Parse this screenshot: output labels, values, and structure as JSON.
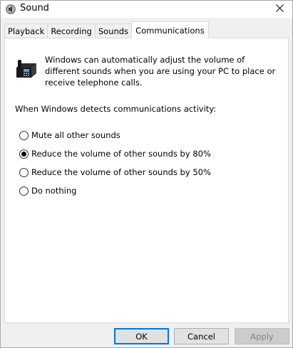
{
  "window": {
    "title": "Sound",
    "app_icon": "speaker-icon",
    "close_icon": "close-icon"
  },
  "tabs": [
    {
      "label": "Playback",
      "active": false
    },
    {
      "label": "Recording",
      "active": false
    },
    {
      "label": "Sounds",
      "active": false
    },
    {
      "label": "Communications",
      "active": true
    }
  ],
  "communications": {
    "icon": "telephone-icon",
    "description": "Windows can automatically adjust the volume of different sounds when you are using your PC to place or receive telephone calls.",
    "detect_label": "When Windows detects communications activity:",
    "options": [
      {
        "label": "Mute all other sounds",
        "selected": false
      },
      {
        "label": "Reduce the volume of other sounds by 80%",
        "selected": true
      },
      {
        "label": "Reduce the volume of other sounds by 50%",
        "selected": false
      },
      {
        "label": "Do nothing",
        "selected": false
      }
    ]
  },
  "buttons": {
    "ok": "OK",
    "cancel": "Cancel",
    "apply": "Apply"
  },
  "colors": {
    "accent": "#0078d7",
    "dialog_bg": "#f0f0f0",
    "panel_bg": "#ffffff"
  }
}
